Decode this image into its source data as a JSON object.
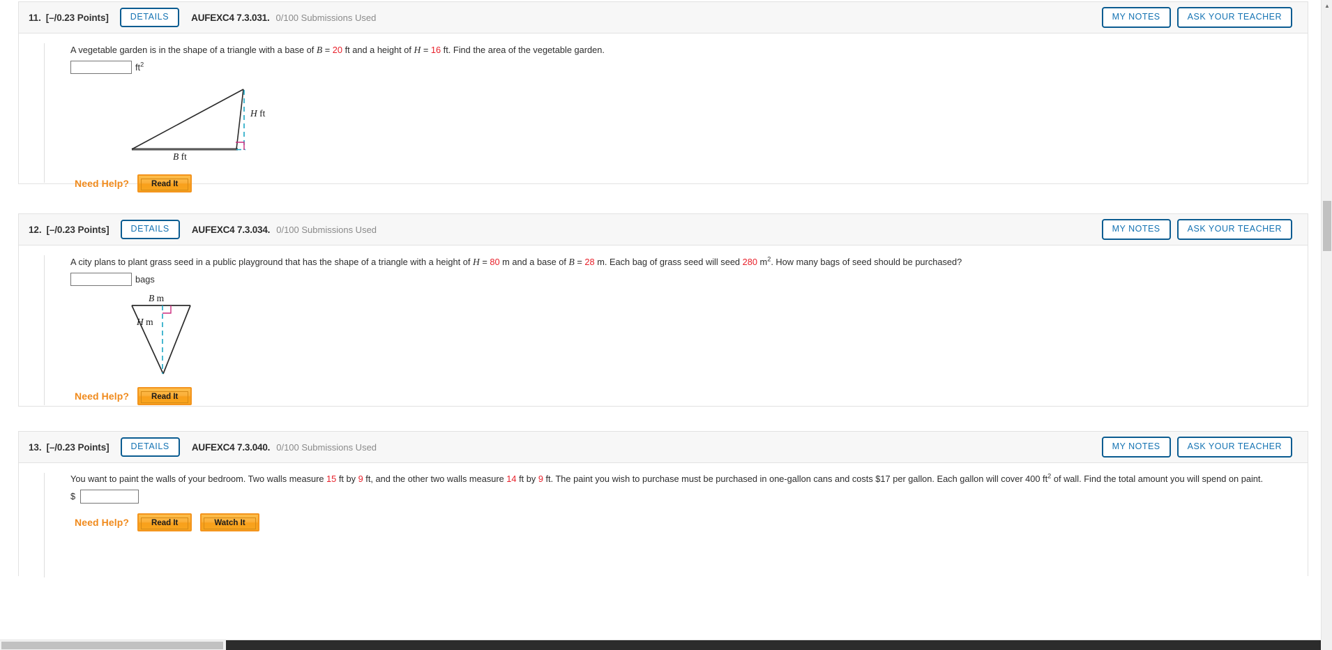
{
  "questions": [
    {
      "number": "11.",
      "points": "[–/0.23 Points]",
      "details_label": "DETAILS",
      "code": "AUFEXC4 7.3.031.",
      "submissions": "0/100 Submissions Used",
      "my_notes_label": "MY NOTES",
      "ask_teacher_label": "ASK YOUR TEACHER",
      "text_parts": [
        {
          "t": "A vegetable garden is in the shape of a triangle with a base of ",
          "k": "plain"
        },
        {
          "t": "B",
          "k": "var"
        },
        {
          "t": " = ",
          "k": "plain"
        },
        {
          "t": "20",
          "k": "num"
        },
        {
          "t": " ft and a height of ",
          "k": "plain"
        },
        {
          "t": "H",
          "k": "var"
        },
        {
          "t": " = ",
          "k": "plain"
        },
        {
          "t": "16",
          "k": "num"
        },
        {
          "t": " ft. Find the area of the vegetable garden.",
          "k": "plain"
        }
      ],
      "answer_value": "",
      "answer_unit": "ft",
      "answer_unit_sup": "2",
      "figure": "triangle-right-scalene",
      "figure_base_label": "B ft",
      "figure_height_label": "H ft",
      "need_help_label": "Need Help?",
      "help_buttons": [
        "Read It"
      ]
    },
    {
      "number": "12.",
      "points": "[–/0.23 Points]",
      "details_label": "DETAILS",
      "code": "AUFEXC4 7.3.034.",
      "submissions": "0/100 Submissions Used",
      "my_notes_label": "MY NOTES",
      "ask_teacher_label": "ASK YOUR TEACHER",
      "text_parts": [
        {
          "t": "A city plans to plant grass seed in a public playground that has the shape of a triangle with a height of ",
          "k": "plain"
        },
        {
          "t": "H",
          "k": "var"
        },
        {
          "t": " = ",
          "k": "plain"
        },
        {
          "t": "80",
          "k": "num"
        },
        {
          "t": " m and a base of ",
          "k": "plain"
        },
        {
          "t": "B",
          "k": "var"
        },
        {
          "t": " = ",
          "k": "plain"
        },
        {
          "t": "28",
          "k": "num"
        },
        {
          "t": " m. Each bag of grass seed will seed ",
          "k": "plain"
        },
        {
          "t": "280",
          "k": "num"
        },
        {
          "t": " m",
          "k": "plain"
        },
        {
          "t": "2",
          "k": "sup"
        },
        {
          "t": ". How many bags of seed should be purchased?",
          "k": "plain"
        }
      ],
      "answer_value": "",
      "answer_unit": "bags",
      "answer_unit_sup": "",
      "figure": "triangle-inverted",
      "figure_base_label": "B m",
      "figure_height_label": "H m",
      "need_help_label": "Need Help?",
      "help_buttons": [
        "Read It"
      ]
    },
    {
      "number": "13.",
      "points": "[–/0.23 Points]",
      "details_label": "DETAILS",
      "code": "AUFEXC4 7.3.040.",
      "submissions": "0/100 Submissions Used",
      "my_notes_label": "MY NOTES",
      "ask_teacher_label": "ASK YOUR TEACHER",
      "text_parts": [
        {
          "t": "You want to paint the walls of your bedroom. Two walls measure ",
          "k": "plain"
        },
        {
          "t": "15",
          "k": "num"
        },
        {
          "t": " ft by ",
          "k": "plain"
        },
        {
          "t": "9",
          "k": "num"
        },
        {
          "t": " ft, and the other two walls measure ",
          "k": "plain"
        },
        {
          "t": "14",
          "k": "num"
        },
        {
          "t": " ft by ",
          "k": "plain"
        },
        {
          "t": "9",
          "k": "num"
        },
        {
          "t": " ft. The paint you wish to purchase must be purchased in one-gallon cans and costs $17 per gallon. Each gallon will cover 400 ft",
          "k": "plain"
        },
        {
          "t": "2",
          "k": "sup"
        },
        {
          "t": " of wall. Find the total amount you will spend on paint.",
          "k": "plain"
        }
      ],
      "answer_value": "",
      "answer_prefix": "$",
      "answer_unit": "",
      "answer_unit_sup": "",
      "figure": "none",
      "need_help_label": "Need Help?",
      "help_buttons": [
        "Read It",
        "Watch It"
      ]
    }
  ],
  "colors": {
    "accent_blue": "#1473b3",
    "border_blue": "#0b5c91",
    "red_value": "#e8202a",
    "orange": "#f08a1c",
    "figure_stroke": "#2b2b2b",
    "figure_dash": "#1aa7c4",
    "figure_angle": "#cc2a7e"
  },
  "scrollbars": {
    "vertical_up_icon": "▲",
    "vertical_down_icon": "▼"
  }
}
